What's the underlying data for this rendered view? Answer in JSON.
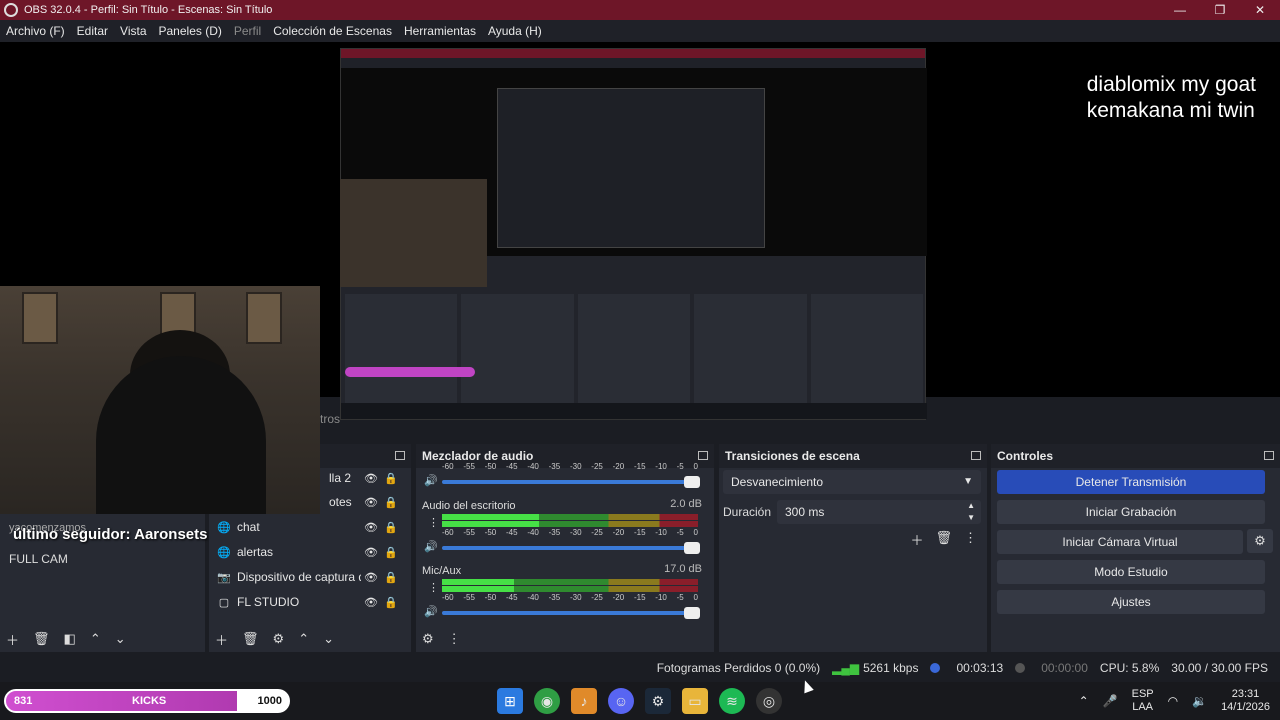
{
  "window": {
    "title": "OBS 32.0.4 - Perfil: Sin Título - Escenas: Sin Título",
    "controls": [
      "—",
      "❐",
      "✕"
    ]
  },
  "menu": [
    "Archivo (F)",
    "Editar",
    "Vista",
    "Paneles (D)",
    "Perfil",
    "Colección de Escenas",
    "Herramientas",
    "Ayuda (H)"
  ],
  "preview_overlay": {
    "line1": "diablomix my goat",
    "line2": "kemakana mi twin"
  },
  "scenes_tab_text": "tros",
  "scenes": {
    "overlay_yaco": "yacomenzamos",
    "follower_text": "último seguidor: Aaronsets",
    "items": [
      "FULL CAM"
    ]
  },
  "sources": {
    "partial_items": [
      "lla 2",
      "otes"
    ],
    "items": [
      {
        "icon": "chat-icon",
        "label": "chat"
      },
      {
        "icon": "alert-icon",
        "label": "alertas"
      },
      {
        "icon": "camera-icon",
        "label": "Dispositivo de captura de vídeo"
      },
      {
        "icon": "monitor-icon",
        "label": "FL STUDIO"
      }
    ]
  },
  "mixer": {
    "title": "Mezclador de audio",
    "scale": [
      "-60",
      "-55",
      "-50",
      "-45",
      "-40",
      "-35",
      "-30",
      "-25",
      "-20",
      "-15",
      "-10",
      "-5",
      "0"
    ],
    "channels": [
      {
        "name": "Audio del escritorio",
        "db": "2.0 dB",
        "level": 0.38
      },
      {
        "name": "Mic/Aux",
        "db": "17.0 dB",
        "level": 0.28
      }
    ]
  },
  "transitions": {
    "title": "Transiciones de escena",
    "selected": "Desvanecimiento",
    "duration_label": "Duración",
    "duration_value": "300 ms"
  },
  "controls": {
    "title": "Controles",
    "buttons": [
      "Detener Transmisión",
      "Iniciar Grabación",
      "Iniciar Cámara Virtual",
      "Modo Estudio",
      "Ajustes"
    ]
  },
  "status": {
    "dropped": "Fotogramas Perdidos 0 (0.0%)",
    "bitrate": "5261 kbps",
    "stream_time": "00:03:13",
    "rec_time": "00:00:00",
    "cpu": "CPU: 5.8%",
    "fps": "30.00 / 30.00 FPS"
  },
  "kicks_bar": {
    "left": "831",
    "center": "KICKS",
    "right": "1000",
    "progress": 0.83
  },
  "tray": {
    "lang1": "ESP",
    "lang2": "LAA",
    "time": "23:31",
    "date": "14/1/2026"
  }
}
